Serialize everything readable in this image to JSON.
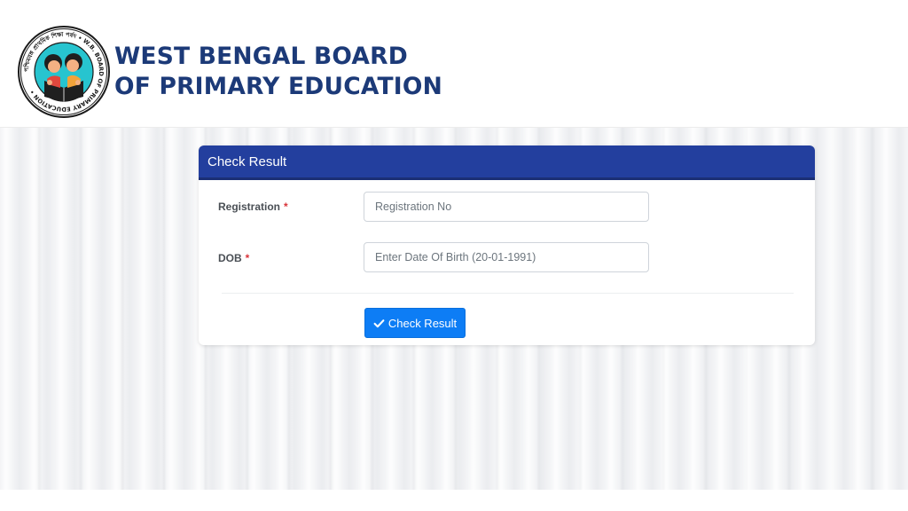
{
  "header": {
    "brand_line1": "WEST BENGAL BOARD",
    "brand_line2": "OF PRIMARY EDUCATION",
    "logo_text": "পশ্চিমবঙ্গ প্রাথমিক শিক্ষা পর্ষদ • W.B. BOARD OF PRIMARY EDUCATION •"
  },
  "form": {
    "title": "Check Result",
    "registration": {
      "label": "Registration",
      "required_mark": "*",
      "placeholder": "Registration No",
      "value": ""
    },
    "dob": {
      "label": "DOB",
      "required_mark": "*",
      "placeholder": "Enter Date Of Birth (20-01-1991)",
      "value": ""
    },
    "submit_label": "Check Result",
    "submit_icon": "check-icon"
  },
  "colors": {
    "brand_text": "#1c3a78",
    "card_header": "#233f9e",
    "button": "#0d7df5",
    "logo_teal": "#27c4cf",
    "required": "#d9343a"
  }
}
